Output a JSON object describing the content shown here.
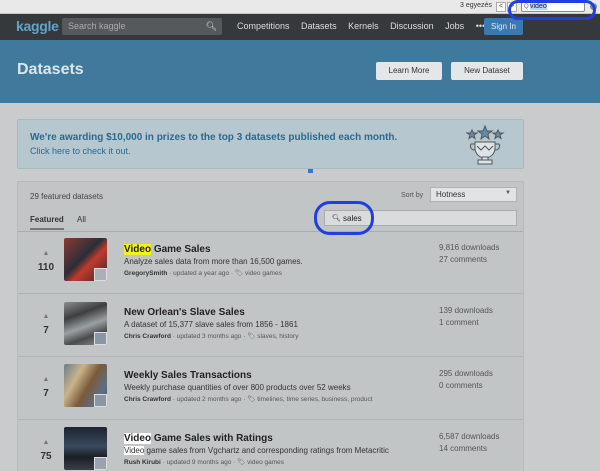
{
  "findbar": {
    "count": "3 egyezés",
    "prev": "<",
    "next": ">",
    "query": "video",
    "mag": "Q"
  },
  "nav": {
    "logo": "kaggle",
    "search_placeholder": "Search kaggle",
    "search_icon": "search-icon",
    "links": [
      "Competitions",
      "Datasets",
      "Kernels",
      "Discussion",
      "Jobs",
      "•••"
    ],
    "signin": "Sign In"
  },
  "banner": {
    "title": "Datasets",
    "learn_more": "Learn More",
    "new_dataset": "New Dataset"
  },
  "prize": {
    "line1": "We're awarding $10,000 in prizes to the top 3 datasets published each month.",
    "line2": "Click here to check it out."
  },
  "listing": {
    "count": "29 featured datasets",
    "sort_label": "Sort by",
    "sort_value": "Hotness",
    "tabs": [
      "Featured",
      "All"
    ],
    "filter_value": "sales",
    "rows": [
      {
        "votes": "110",
        "title_hl": "Video",
        "title_rest": " Game Sales",
        "subtitle_hl": "",
        "subtitle": "Analyze sales data from more than 16,500 games.",
        "author": "GregorySmith",
        "updated": " · updated a year ago · ",
        "tags": "video games",
        "downloads": "9,816 downloads",
        "comments": "27 comments"
      },
      {
        "votes": "7",
        "title_hl": "",
        "title_rest": "New Orlean's Slave Sales",
        "subtitle_hl": "",
        "subtitle": "A dataset of 15,377 slave sales from 1856 - 1861",
        "author": "Chris Crawford",
        "updated": " · updated 3 months ago · ",
        "tags": "slaves, history",
        "downloads": "139 downloads",
        "comments": "1 comment"
      },
      {
        "votes": "7",
        "title_hl": "",
        "title_rest": "Weekly Sales Transactions",
        "subtitle_hl": "",
        "subtitle": "Weekly purchase quantities of over 800 products over 52 weeks",
        "author": "Chris Crawford",
        "updated": " · updated 2 months ago · ",
        "tags": "timelines, time series, business, product",
        "downloads": "295 downloads",
        "comments": "0 comments"
      },
      {
        "votes": "75",
        "title_hl": "Video",
        "title_rest": " Game Sales with Ratings",
        "subtitle_hl": "Video",
        "subtitle": " game sales from Vgchartz and corresponding ratings from Metacritic",
        "author": "Rush Kirubi",
        "updated": " · updated 9 months ago · ",
        "tags": "video games",
        "downloads": "6,587 downloads",
        "comments": "14 comments"
      }
    ]
  }
}
